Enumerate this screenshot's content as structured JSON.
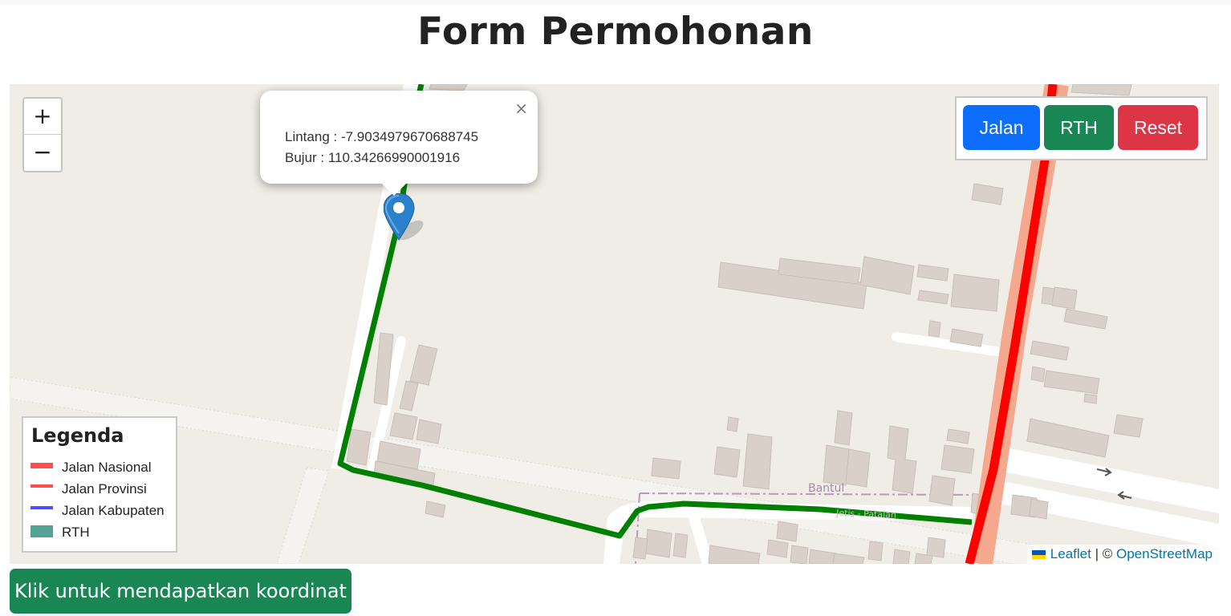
{
  "page": {
    "title": "Form Permohonan"
  },
  "map": {
    "zoom_in_label": "+",
    "zoom_out_label": "−",
    "popup": {
      "close_label": "×",
      "lintang_text": "Lintang : -7.9034979670688745",
      "bujur_text": "Bujur : 110.34266990001916"
    },
    "area_label": "Bantul",
    "road_label": "Jetis - Patalan",
    "layer_buttons": {
      "jalan_label": "Jalan",
      "rth_label": "RTH",
      "reset_label": "Reset",
      "jalan_color": "#0d6efd",
      "rth_color": "#198754",
      "reset_color": "#dc3545"
    },
    "legend": {
      "title": "Legenda",
      "items": [
        {
          "label": "Jalan Nasional",
          "color": "#ff4d4d"
        },
        {
          "label": "Jalan Provinsi",
          "color": "#ff4d4d"
        },
        {
          "label": "Jalan Kabupaten",
          "color": "#4d4dff"
        },
        {
          "label": "RTH",
          "color": "#52a393"
        }
      ]
    },
    "attribution": {
      "leaflet_label": "Leaflet",
      "separator": "| ©",
      "osm_label": "OpenStreetMap"
    },
    "route_color": "#008000",
    "national_road_color": "#ff0000"
  },
  "actions": {
    "coord_button_label": "Klik untuk mendapatkan koordinat"
  }
}
